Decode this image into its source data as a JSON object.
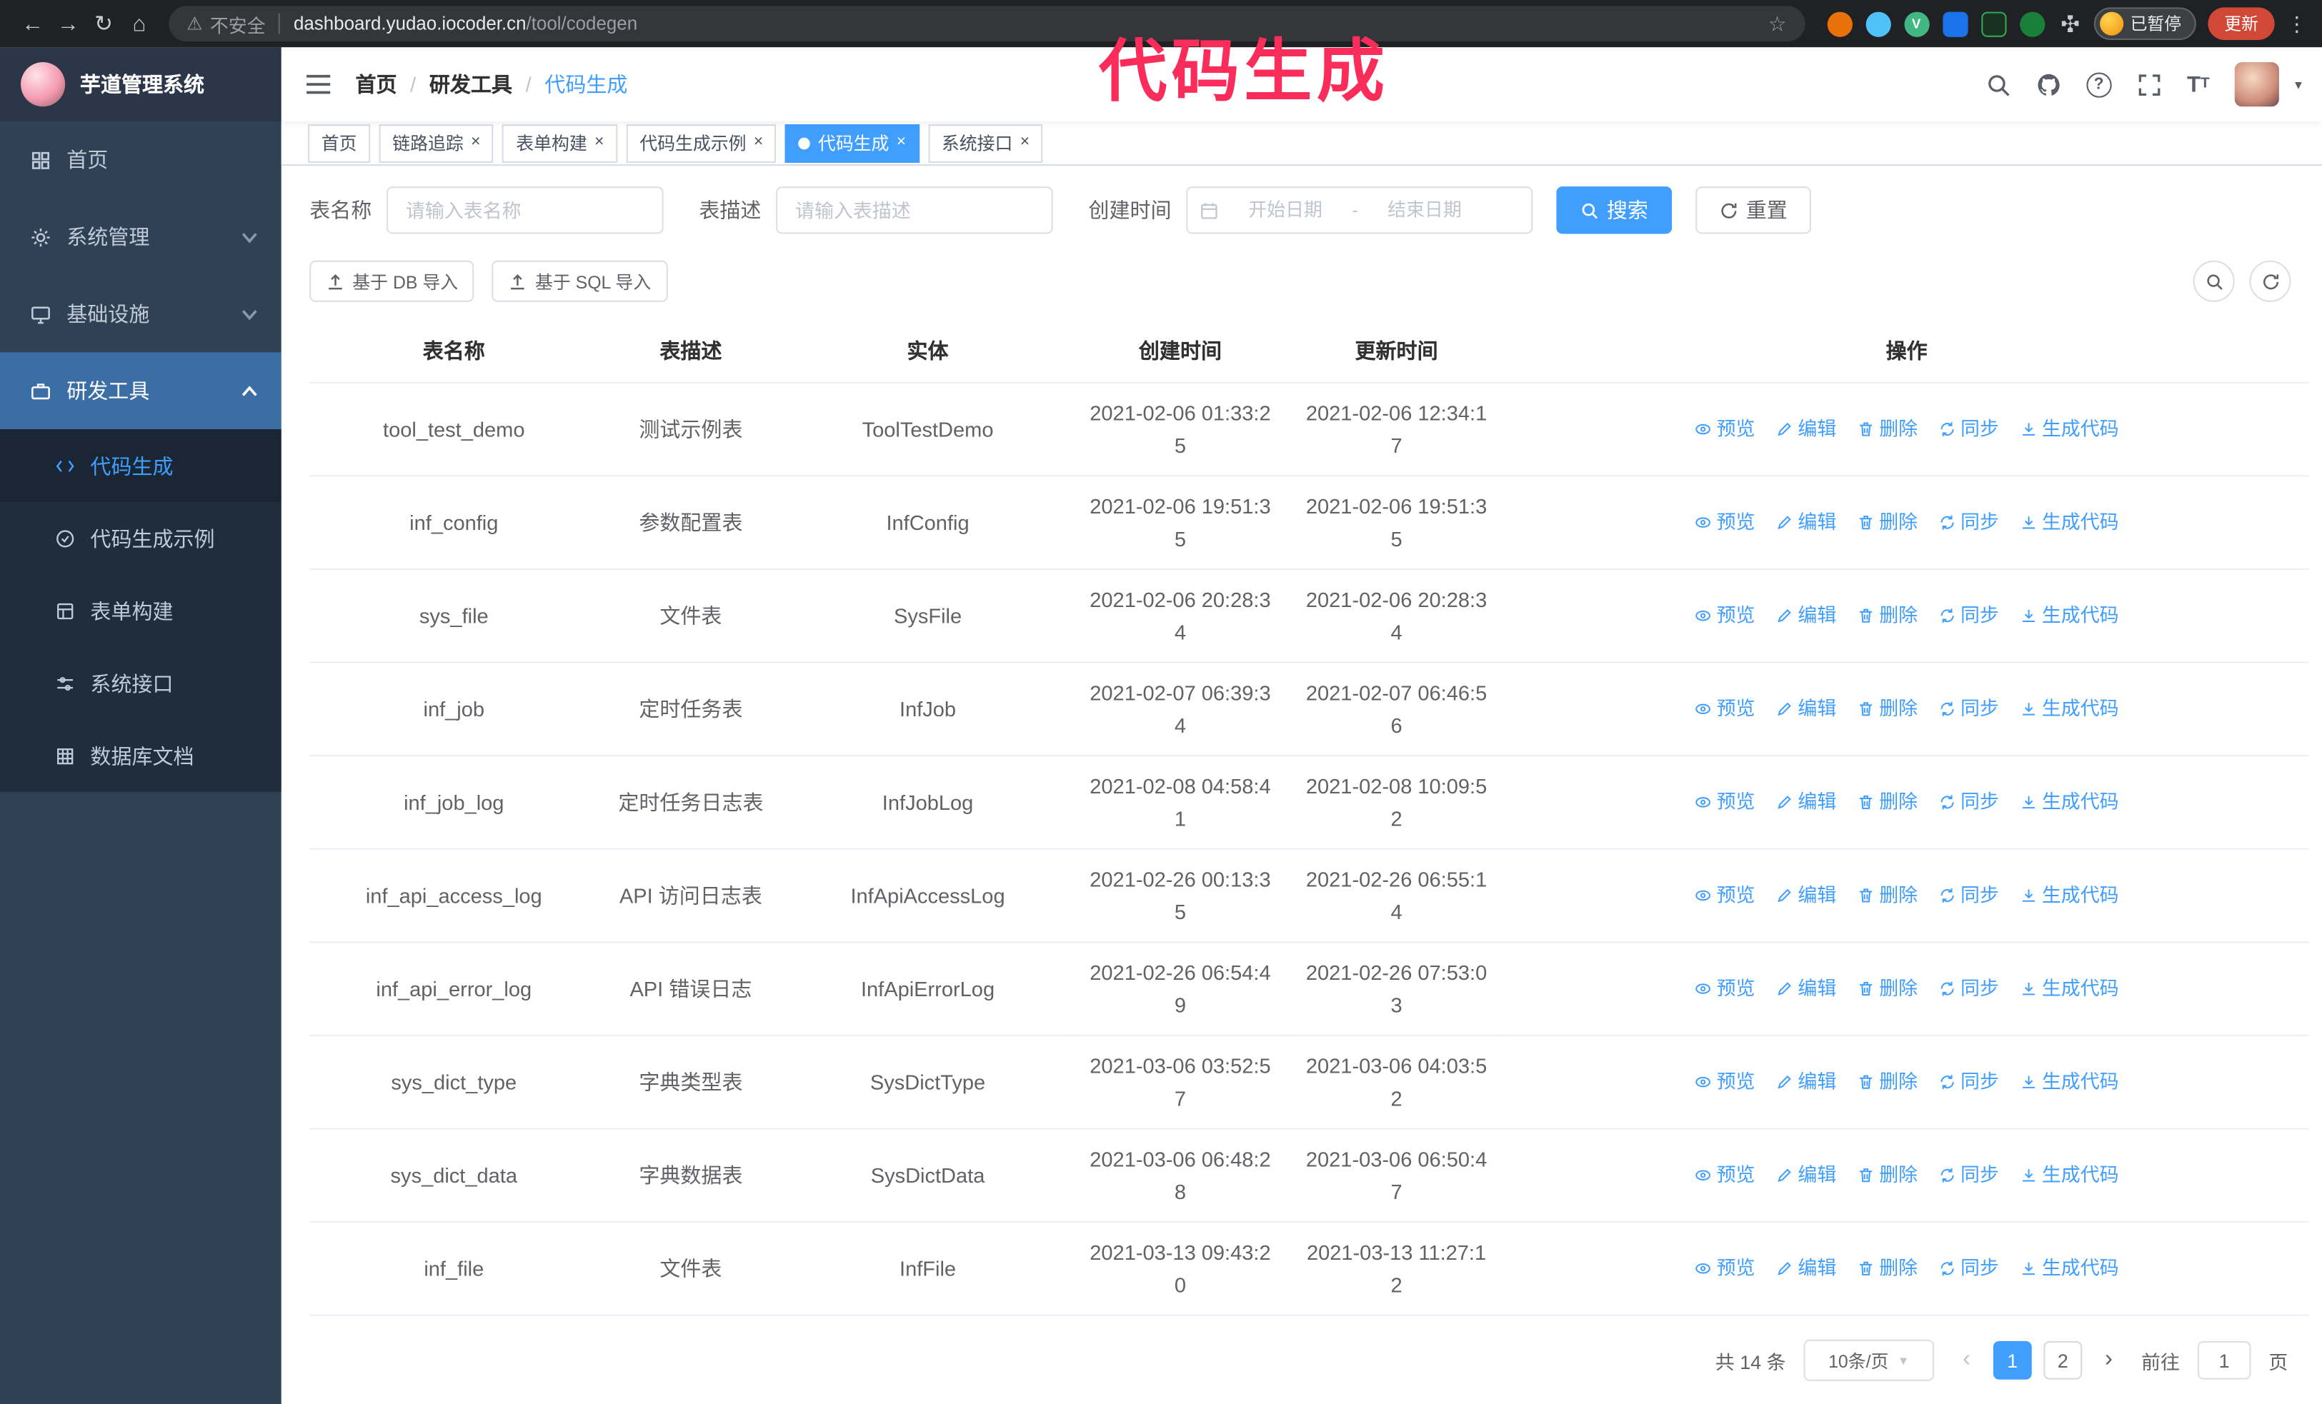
{
  "colors": {
    "accent": "#409eff",
    "annotation": "#fa2c5a",
    "update_button": "#d14836",
    "sidebar_bg": "#304156",
    "submenu_bg": "#1f2d3d"
  },
  "icons": {
    "back": "←",
    "forward": "→",
    "reload": "↻",
    "home": "⌂",
    "warning": "⚠",
    "star": "☆",
    "kebab": "⋮",
    "caret_down": "▼",
    "close": "×",
    "question": "?",
    "font_large": "T",
    "font_small": "T",
    "pager_prev": "‹",
    "pager_next": "›",
    "vue_ext": "V"
  },
  "browser": {
    "security_label": "不安全",
    "url_host": "dashboard.yudao.iocoder.cn",
    "url_path": "/tool/codegen",
    "paused_badge": "已暂停",
    "update_button": "更新"
  },
  "annotation": {
    "text": "代码生成"
  },
  "sidebar": {
    "logo_title": "芋道管理系统",
    "items": [
      {
        "label": "首页"
      },
      {
        "label": "系统管理"
      },
      {
        "label": "基础设施"
      },
      {
        "label": "研发工具"
      }
    ],
    "subitems": [
      {
        "label": "代码生成"
      },
      {
        "label": "代码生成示例"
      },
      {
        "label": "表单构建"
      },
      {
        "label": "系统接口"
      },
      {
        "label": "数据库文档"
      }
    ]
  },
  "header": {
    "breadcrumb": [
      "首页",
      "研发工具",
      "代码生成"
    ],
    "breadcrumb_separator": "/"
  },
  "tabs": [
    {
      "label": "首页"
    },
    {
      "label": "链路追踪"
    },
    {
      "label": "表单构建"
    },
    {
      "label": "代码生成示例"
    },
    {
      "label": "代码生成"
    },
    {
      "label": "系统接口"
    }
  ],
  "filters": {
    "table_name_label": "表名称",
    "table_name_placeholder": "请输入表名称",
    "table_desc_label": "表描述",
    "table_desc_placeholder": "请输入表描述",
    "create_time_label": "创建时间",
    "date_start_placeholder": "开始日期",
    "date_separator": "-",
    "date_end_placeholder": "结束日期",
    "search_button": "搜索",
    "reset_button": "重置"
  },
  "toolbar": {
    "import_db_button": "基于 DB 导入",
    "import_sql_button": "基于 SQL 导入"
  },
  "table": {
    "columns": [
      "表名称",
      "表描述",
      "实体",
      "创建时间",
      "更新时间",
      "操作"
    ],
    "action_labels": {
      "preview": "预览",
      "edit": "编辑",
      "delete": "删除",
      "sync": "同步",
      "generate": "生成代码"
    },
    "rows": [
      {
        "name": "tool_test_demo",
        "desc": "测试示例表",
        "entity": "ToolTestDemo",
        "create_time": "2021-02-06 01:33:25",
        "update_time": "2021-02-06 12:34:17"
      },
      {
        "name": "inf_config",
        "desc": "参数配置表",
        "entity": "InfConfig",
        "create_time": "2021-02-06 19:51:35",
        "update_time": "2021-02-06 19:51:35"
      },
      {
        "name": "sys_file",
        "desc": "文件表",
        "entity": "SysFile",
        "create_time": "2021-02-06 20:28:34",
        "update_time": "2021-02-06 20:28:34"
      },
      {
        "name": "inf_job",
        "desc": "定时任务表",
        "entity": "InfJob",
        "create_time": "2021-02-07 06:39:34",
        "update_time": "2021-02-07 06:46:56"
      },
      {
        "name": "inf_job_log",
        "desc": "定时任务日志表",
        "entity": "InfJobLog",
        "create_time": "2021-02-08 04:58:41",
        "update_time": "2021-02-08 10:09:52"
      },
      {
        "name": "inf_api_access_log",
        "desc": "API 访问日志表",
        "entity": "InfApiAccessLog",
        "create_time": "2021-02-26 00:13:35",
        "update_time": "2021-02-26 06:55:14"
      },
      {
        "name": "inf_api_error_log",
        "desc": "API 错误日志",
        "entity": "InfApiErrorLog",
        "create_time": "2021-02-26 06:54:49",
        "update_time": "2021-02-26 07:53:03"
      },
      {
        "name": "sys_dict_type",
        "desc": "字典类型表",
        "entity": "SysDictType",
        "create_time": "2021-03-06 03:52:57",
        "update_time": "2021-03-06 04:03:52"
      },
      {
        "name": "sys_dict_data",
        "desc": "字典数据表",
        "entity": "SysDictData",
        "create_time": "2021-03-06 06:48:28",
        "update_time": "2021-03-06 06:50:47"
      },
      {
        "name": "inf_file",
        "desc": "文件表",
        "entity": "InfFile",
        "create_time": "2021-03-13 09:43:20",
        "update_time": "2021-03-13 11:27:12"
      }
    ]
  },
  "pagination": {
    "total_text": "共 14 条",
    "page_size": "10条/页",
    "pages": [
      "1",
      "2"
    ],
    "goto_label": "前往",
    "goto_value": "1",
    "goto_suffix": "页"
  }
}
